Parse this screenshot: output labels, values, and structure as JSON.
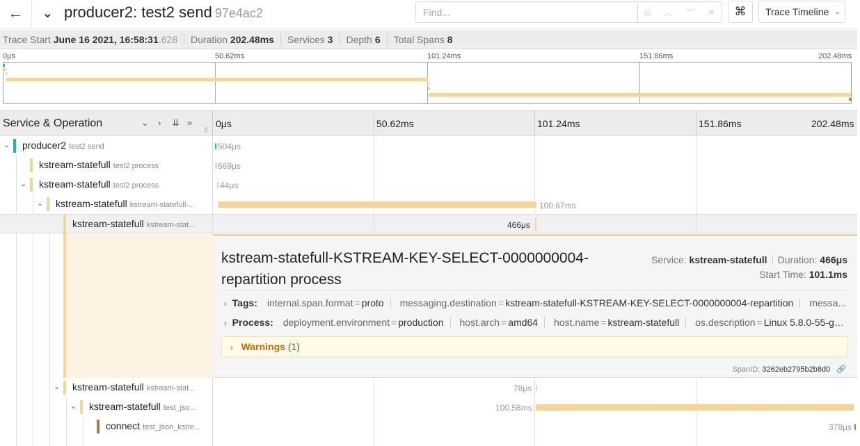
{
  "header": {
    "title": "producer2: test2 send",
    "trace_id": "97e4ac2",
    "find_placeholder": "Find...",
    "cmd_glyph": "⌘",
    "view_label": "Trace Timeline"
  },
  "summary": {
    "trace_start_label": "Trace Start",
    "trace_start_value": "June 16 2021, 16:58:31",
    "trace_start_ms": ".628",
    "duration_label": "Duration",
    "duration_value": "202.48ms",
    "services_label": "Services",
    "services_value": "3",
    "depth_label": "Depth",
    "depth_value": "6",
    "total_spans_label": "Total Spans",
    "total_spans_value": "8"
  },
  "ticks": [
    "0μs",
    "50.62ms",
    "101.24ms",
    "151.86ms",
    "202.48ms"
  ],
  "grid": {
    "header_label": "Service & Operation"
  },
  "colors": {
    "producer2": "#17b8be",
    "kstream_statefull": "#f5d49a",
    "connect": "#b07a48"
  },
  "rows": [
    {
      "service": "producer2",
      "operation": "test2 send",
      "duration": "504μs",
      "start_ms": 0.0,
      "duration_ms": 0.504
    },
    {
      "service": "kstream-statefull",
      "operation": "test2 process",
      "duration": "669μs",
      "start_ms": 0.0,
      "duration_ms": 0.669
    },
    {
      "service": "kstream-statefull",
      "operation": "test2 process",
      "duration": "44μs",
      "start_ms": 0.7,
      "duration_ms": 0.044
    },
    {
      "service": "kstream-statefull",
      "operation": "kstream-statefull-...",
      "duration": "100.67ms",
      "start_ms": 0.8,
      "duration_ms": 100.67
    },
    {
      "service": "kstream-statefull",
      "operation": "kstream-stat...",
      "duration": "466μs",
      "start_ms": 101.1,
      "duration_ms": 0.466
    },
    {
      "service": "kstream-statefull",
      "operation": "kstream-stat...",
      "duration": "78μs",
      "start_ms": 101.3,
      "duration_ms": 0.078
    },
    {
      "service": "kstream-statefull",
      "operation": "test_jso...",
      "duration": "100.58ms",
      "start_ms": 101.4,
      "duration_ms": 100.58
    },
    {
      "service": "connect",
      "operation": "test_json_kstre...",
      "duration": "378μs",
      "start_ms": 202.0,
      "duration_ms": 0.378
    }
  ],
  "detail": {
    "title": "kstream-statefull-KSTREAM-KEY-SELECT-0000000004-repartition process",
    "service_label": "Service:",
    "service_value": "kstream-statefull",
    "duration_label": "Duration:",
    "duration_value": "466μs",
    "start_label": "Start Time:",
    "start_value": "101.1ms",
    "tags_label": "Tags:",
    "tags": [
      {
        "k": "internal.span.format",
        "v": "proto"
      },
      {
        "k": "messaging.destination",
        "v": "kstream-statefull-KSTREAM-KEY-SELECT-0000000004-repartition"
      },
      {
        "k": "messa...",
        "v": ""
      }
    ],
    "process_label": "Process:",
    "process": [
      {
        "k": "deployment.environment",
        "v": "production"
      },
      {
        "k": "host.arch",
        "v": "amd64"
      },
      {
        "k": "host.name",
        "v": "kstream-statefull"
      },
      {
        "k": "os.description",
        "v": "Linux 5.8.0-55-ge..."
      }
    ],
    "warnings_label": "Warnings",
    "warnings_count": "(1)",
    "spanid_label": "SpanID:",
    "spanid_value": "3262eb2795b2b8d0"
  }
}
